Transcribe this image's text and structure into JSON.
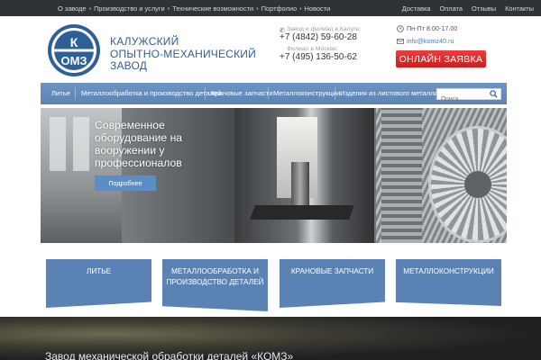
{
  "topnav": {
    "left": [
      "О заводе",
      "Производство и услуги",
      "Технические возможности",
      "Портфолио",
      "Новости"
    ],
    "right": [
      "Доставка",
      "Оплата",
      "Отзывы",
      "Контакты"
    ]
  },
  "brand": {
    "logo_text": "КОМЗ",
    "lines": [
      "КАЛУЖСКИЙ",
      "ОПЫТНО-МЕХАНИЧЕСКИЙ",
      "ЗАВОД"
    ]
  },
  "contacts": {
    "kaluga_label": "Завод и филиал в Калуге:",
    "kaluga_phone": "+7 (4842) 59-60-28",
    "moscow_label": "Филиал в Москве:",
    "moscow_phone": "+7 (495) 136-50-62",
    "hours": "Пн-Пт 8.00-17.00",
    "email": "info@komz40.ru"
  },
  "order_button": "ОНЛАЙН ЗАЯВКА",
  "mainnav": {
    "items": [
      "Литье",
      "Металлообработка и производство деталей",
      "Крановые запчасти",
      "Металлоконструкции",
      "Изделия из листового металла"
    ],
    "search_placeholder": "Поиск..."
  },
  "hero": {
    "lines": [
      "Современное",
      "оборудование на",
      "вооружении у",
      "профессионалов"
    ],
    "button": "Подробнее"
  },
  "tiles": [
    [
      "ЛИТЬЕ"
    ],
    [
      "МЕТАЛЛООБРАБОТКА И",
      "ПРОИЗВОДСТВО ДЕТАЛЕЙ"
    ],
    [
      "КРАНОВЫЕ ЗАПЧАСТИ"
    ],
    [
      "МЕТАЛЛОКОНСТРУКЦИИ"
    ]
  ],
  "bottom_title": "Завод механической обработки деталей «КОМЗ»",
  "colors": {
    "topbar": "#2f3236",
    "brand_blue": "#2f5f97",
    "nav_blue": "#5b83b3",
    "order_red": "#cf1d1d"
  },
  "icons": [
    "phone-icon",
    "clock-icon",
    "mail-icon",
    "search-icon"
  ]
}
